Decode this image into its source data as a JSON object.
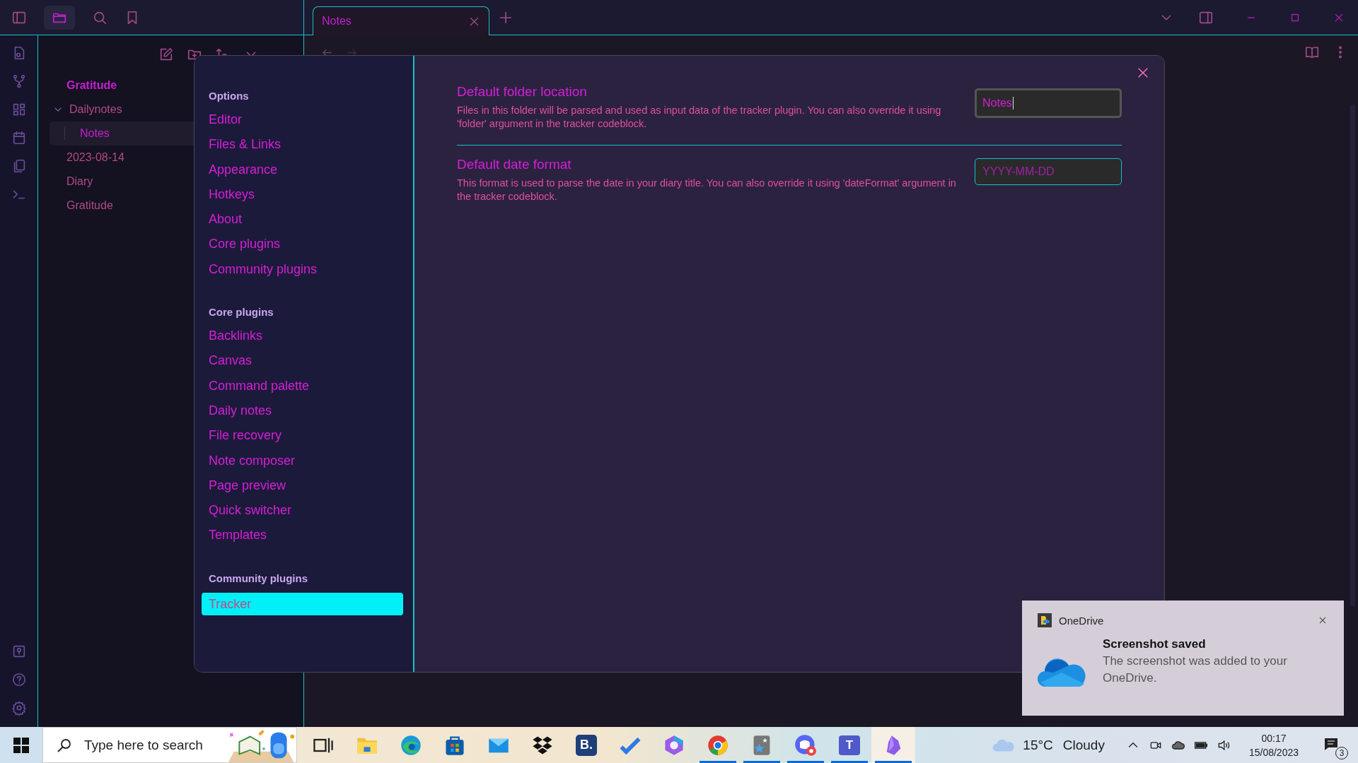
{
  "tabs": [
    {
      "label": "Notes",
      "selected": true
    }
  ],
  "file_tree": [
    {
      "label": "Gratitude",
      "kind": "pinned",
      "selected": false
    },
    {
      "label": "Dailynotes",
      "kind": "folder",
      "selected": false,
      "expanded": true,
      "children": [
        {
          "label": "Notes",
          "selected": true
        }
      ]
    },
    {
      "label": "2023-08-14",
      "kind": "file",
      "selected": false
    },
    {
      "label": "Diary",
      "kind": "file",
      "selected": false
    },
    {
      "label": "Gratitude",
      "kind": "file",
      "selected": false
    }
  ],
  "settings": {
    "nav": [
      {
        "heading": "Options",
        "items": [
          {
            "label": "Editor",
            "selected": false
          },
          {
            "label": "Files & Links",
            "selected": false
          },
          {
            "label": "Appearance",
            "selected": false
          },
          {
            "label": "Hotkeys",
            "selected": false
          },
          {
            "label": "About",
            "selected": false
          },
          {
            "label": "Core plugins",
            "selected": false
          },
          {
            "label": "Community plugins",
            "selected": false
          }
        ]
      },
      {
        "heading": "Core plugins",
        "items": [
          {
            "label": "Backlinks",
            "selected": false
          },
          {
            "label": "Canvas",
            "selected": false
          },
          {
            "label": "Command palette",
            "selected": false
          },
          {
            "label": "Daily notes",
            "selected": false
          },
          {
            "label": "File recovery",
            "selected": false
          },
          {
            "label": "Note composer",
            "selected": false
          },
          {
            "label": "Page preview",
            "selected": false
          },
          {
            "label": "Quick switcher",
            "selected": false
          },
          {
            "label": "Templates",
            "selected": false
          }
        ]
      },
      {
        "heading": "Community plugins",
        "items": [
          {
            "label": "Tracker",
            "selected": true
          }
        ]
      }
    ],
    "rows": [
      {
        "name": "Default folder location",
        "description": "Files in this folder will be parsed and used as input data of the tracker plugin. You can also override it using 'folder' argument in the tracker codeblock.",
        "value": "Notes",
        "focused": true
      },
      {
        "name": "Default date format",
        "description": "This format is used to parse the date in your diary title. You can also override it using 'dateFormat' argument in the tracker codeblock.",
        "placeholder": "YYYY-MM-DD",
        "focused": false
      }
    ]
  },
  "notification": {
    "app": "OneDrive",
    "title": "Screenshot saved",
    "body": "The screenshot was added to your OneDrive."
  },
  "taskbar": {
    "search_placeholder": "Type here to search",
    "apps": [
      {
        "kind": "taskview",
        "running": false,
        "active": false
      },
      {
        "kind": "explorer",
        "running": false,
        "active": false
      },
      {
        "kind": "edge",
        "running": false,
        "active": false
      },
      {
        "kind": "store",
        "running": false,
        "active": false
      },
      {
        "kind": "mail",
        "running": false,
        "active": false
      },
      {
        "kind": "dropbox",
        "running": false,
        "active": false
      },
      {
        "kind": "booking",
        "text": "B.",
        "running": false,
        "active": false
      },
      {
        "kind": "todo",
        "running": false,
        "active": false
      },
      {
        "kind": "office",
        "running": false,
        "active": false
      },
      {
        "kind": "chrome",
        "running": true,
        "active": false
      },
      {
        "kind": "anki",
        "running": true,
        "active": false
      },
      {
        "kind": "discord",
        "running": true,
        "active": false
      },
      {
        "kind": "teams",
        "text": "T",
        "running": true,
        "active": false
      },
      {
        "kind": "obsidian",
        "running": true,
        "active": true
      }
    ],
    "temperature": "15°C",
    "weather": "Cloudy",
    "time": "00:17",
    "date": "15/08/2023",
    "notification_count": "3"
  }
}
